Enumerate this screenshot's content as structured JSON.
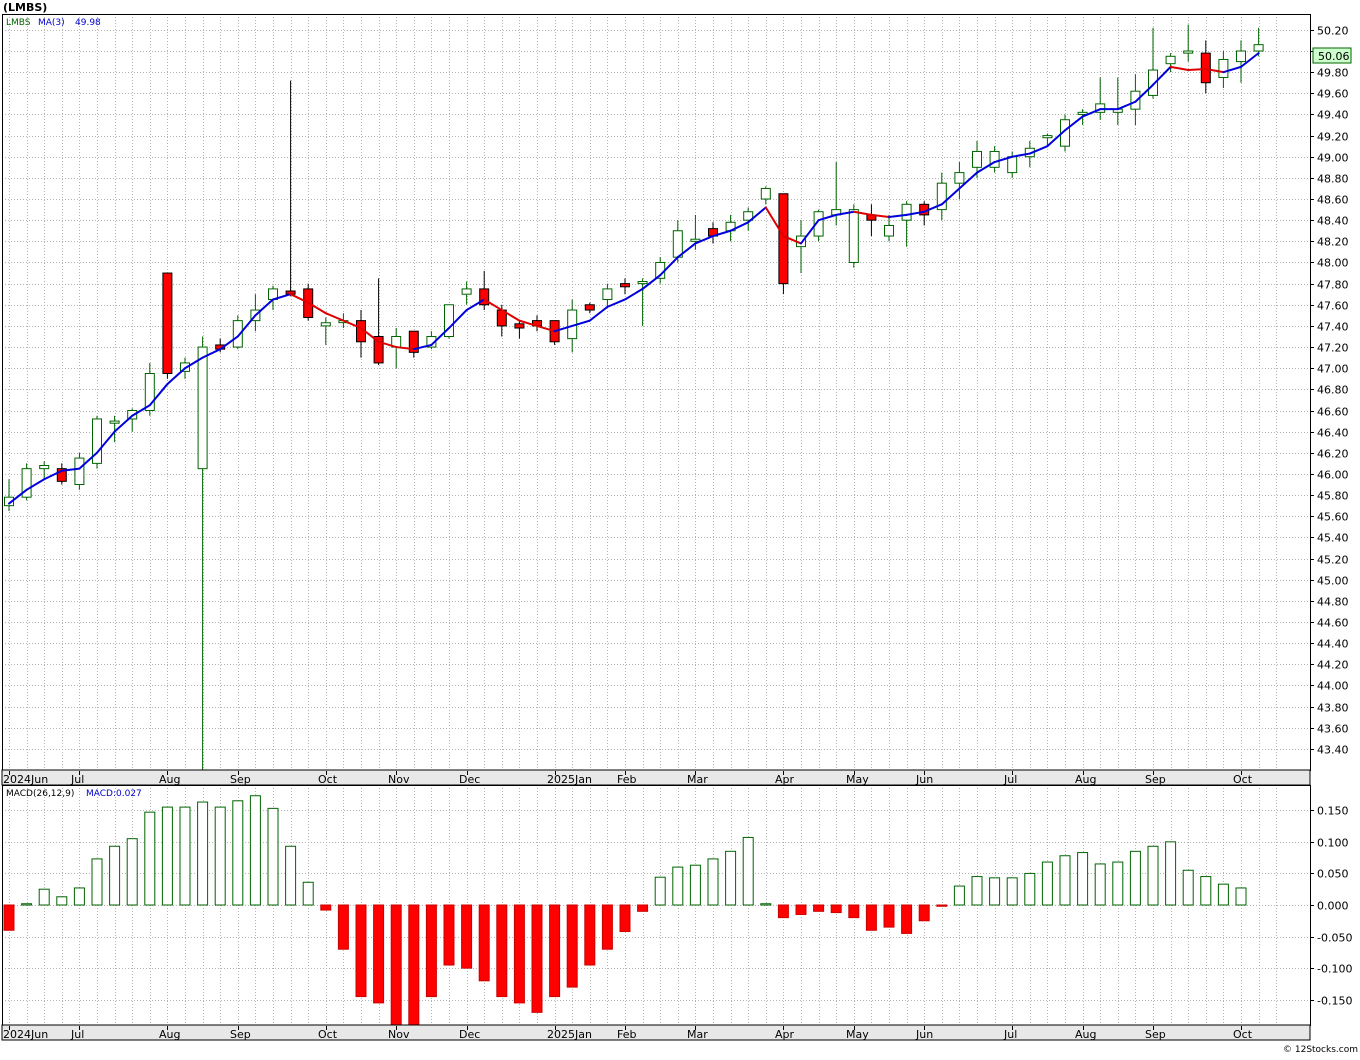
{
  "header": {
    "symbol_title": "(LMBS)",
    "legend_symbol": "LMBS",
    "legend_ma": "MA(3)",
    "legend_ma_value": "49.98",
    "last_price_label": "50.06"
  },
  "macd_legend": {
    "label": "MACD(26,12,9)",
    "value": "MACD:0.027"
  },
  "footer": {
    "copyright": "© 12Stocks.com"
  },
  "colors": {
    "up_candle_stroke": "#006400",
    "down_candle_fill": "#ff0000",
    "ma_up": "#0000dd",
    "ma_down": "#dd0000",
    "grid": "#b4b4b4",
    "price_label_bg": "#ccffcc"
  },
  "chart_data": [
    {
      "type": "candlestick",
      "ylim": [
        43.2,
        50.35
      ],
      "yticks": [
        43.4,
        43.6,
        43.8,
        44.0,
        44.2,
        44.4,
        44.6,
        44.8,
        45.0,
        45.2,
        45.4,
        45.6,
        45.8,
        46.0,
        46.2,
        46.4,
        46.6,
        46.8,
        47.0,
        47.2,
        47.4,
        47.6,
        47.8,
        48.0,
        48.2,
        48.4,
        48.6,
        48.8,
        49.0,
        49.2,
        49.4,
        49.6,
        49.8,
        50.0,
        50.2
      ],
      "ytick_labels": [
        "43.40",
        "43.60",
        "43.80",
        "44.00",
        "44.20",
        "44.40",
        "44.60",
        "44.80",
        "45.00",
        "45.20",
        "45.40",
        "45.60",
        "45.80",
        "46.00",
        "46.20",
        "46.40",
        "46.60",
        "46.80",
        "47.00",
        "47.20",
        "47.40",
        "47.60",
        "47.80",
        "48.00",
        "48.20",
        "48.40",
        "48.60",
        "48.80",
        "49.00",
        "49.20",
        "49.40",
        "49.60",
        "49.80",
        "50.00",
        "50.20"
      ],
      "x_month_labels": [
        "2024Jun",
        "Jul",
        "Aug",
        "Sep",
        "Oct",
        "Nov",
        "Dec",
        "2025Jan",
        "Feb",
        "Mar",
        "Apr",
        "May",
        "Jun",
        "Jul",
        "Aug",
        "Sep",
        "Oct"
      ],
      "x_month_week_index": [
        0,
        4,
        9,
        13,
        18,
        22,
        26,
        31,
        35,
        39,
        44,
        48,
        52,
        57,
        61,
        65,
        70
      ],
      "weeks": 73,
      "ohlc": [
        [
          45.7,
          45.95,
          45.65,
          45.78
        ],
        [
          45.78,
          46.1,
          45.75,
          46.05
        ],
        [
          46.05,
          46.12,
          45.95,
          46.08
        ],
        [
          46.05,
          46.1,
          45.9,
          45.93
        ],
        [
          45.9,
          46.2,
          45.85,
          46.15
        ],
        [
          46.1,
          46.55,
          46.05,
          46.52
        ],
        [
          46.48,
          46.55,
          46.3,
          46.5
        ],
        [
          46.52,
          46.62,
          46.4,
          46.6
        ],
        [
          46.6,
          47.05,
          46.55,
          46.95
        ],
        [
          47.9,
          47.9,
          46.9,
          46.95
        ],
        [
          46.97,
          47.1,
          46.9,
          47.05
        ],
        [
          46.05,
          47.3,
          43.2,
          47.2
        ],
        [
          47.22,
          47.28,
          47.15,
          47.18
        ],
        [
          47.2,
          47.5,
          47.18,
          47.45
        ],
        [
          47.45,
          47.7,
          47.35,
          47.55
        ],
        [
          47.65,
          47.78,
          47.55,
          47.75
        ],
        [
          47.73,
          49.72,
          47.68,
          47.7
        ],
        [
          47.75,
          47.8,
          47.45,
          47.48
        ],
        [
          47.4,
          47.48,
          47.22,
          47.43
        ],
        [
          47.45,
          47.52,
          47.38,
          47.45
        ],
        [
          47.45,
          47.55,
          47.1,
          47.25
        ],
        [
          47.3,
          47.85,
          47.03,
          47.05
        ],
        [
          47.2,
          47.38,
          47.0,
          47.3
        ],
        [
          47.35,
          47.35,
          47.1,
          47.15
        ],
        [
          47.2,
          47.35,
          47.18,
          47.3
        ],
        [
          47.3,
          47.6,
          47.28,
          47.6
        ],
        [
          47.7,
          47.82,
          47.6,
          47.75
        ],
        [
          47.75,
          47.92,
          47.55,
          47.6
        ],
        [
          47.55,
          47.6,
          47.3,
          47.4
        ],
        [
          47.42,
          47.45,
          47.28,
          47.38
        ],
        [
          47.45,
          47.5,
          47.35,
          47.4
        ],
        [
          47.45,
          47.45,
          47.22,
          47.25
        ],
        [
          47.28,
          47.65,
          47.15,
          47.55
        ],
        [
          47.6,
          47.62,
          47.52,
          47.55
        ],
        [
          47.65,
          47.8,
          47.58,
          47.75
        ],
        [
          47.8,
          47.85,
          47.7,
          47.77
        ],
        [
          47.8,
          47.85,
          47.4,
          47.82
        ],
        [
          47.85,
          48.05,
          47.8,
          48.0
        ],
        [
          48.05,
          48.4,
          48.0,
          48.3
        ],
        [
          48.2,
          48.45,
          48.12,
          48.22
        ],
        [
          48.32,
          48.38,
          48.18,
          48.25
        ],
        [
          48.3,
          48.45,
          48.2,
          48.38
        ],
        [
          48.4,
          48.52,
          48.3,
          48.48
        ],
        [
          48.6,
          48.72,
          48.55,
          48.7
        ],
        [
          48.65,
          48.65,
          47.7,
          47.8
        ],
        [
          48.15,
          48.4,
          47.9,
          48.25
        ],
        [
          48.25,
          48.5,
          48.2,
          48.48
        ],
        [
          48.45,
          48.95,
          48.35,
          48.5
        ],
        [
          48.0,
          48.55,
          47.95,
          48.5
        ],
        [
          48.45,
          48.55,
          48.25,
          48.4
        ],
        [
          48.25,
          48.45,
          48.2,
          48.35
        ],
        [
          48.4,
          48.58,
          48.15,
          48.55
        ],
        [
          48.55,
          48.58,
          48.35,
          48.45
        ],
        [
          48.5,
          48.85,
          48.4,
          48.75
        ],
        [
          48.75,
          48.95,
          48.6,
          48.85
        ],
        [
          48.9,
          49.15,
          48.8,
          49.05
        ],
        [
          48.9,
          49.1,
          48.85,
          49.05
        ],
        [
          48.85,
          49.05,
          48.8,
          49.0
        ],
        [
          49.0,
          49.15,
          48.9,
          49.08
        ],
        [
          49.18,
          49.22,
          49.1,
          49.2
        ],
        [
          49.1,
          49.4,
          49.05,
          49.35
        ],
        [
          49.4,
          49.45,
          49.3,
          49.42
        ],
        [
          49.42,
          49.75,
          49.35,
          49.5
        ],
        [
          49.42,
          49.75,
          49.3,
          49.45
        ],
        [
          49.45,
          49.78,
          49.3,
          49.62
        ],
        [
          49.58,
          50.22,
          49.55,
          49.82
        ],
        [
          49.88,
          49.98,
          49.8,
          49.95
        ],
        [
          49.98,
          50.25,
          49.9,
          50.0
        ],
        [
          49.98,
          50.1,
          49.6,
          49.7
        ],
        [
          49.75,
          50.0,
          49.65,
          49.92
        ],
        [
          49.9,
          50.1,
          49.7,
          50.0
        ],
        [
          50.0,
          50.22,
          49.95,
          50.06
        ]
      ],
      "ma3": [
        45.72,
        45.85,
        45.95,
        46.03,
        46.05,
        46.2,
        46.4,
        46.55,
        46.65,
        46.85,
        47.0,
        47.1,
        47.18,
        47.3,
        47.5,
        47.65,
        47.7,
        47.62,
        47.52,
        47.45,
        47.38,
        47.25,
        47.2,
        47.18,
        47.22,
        47.38,
        47.55,
        47.65,
        47.55,
        47.45,
        47.4,
        47.35,
        47.4,
        47.45,
        47.58,
        47.65,
        47.75,
        47.88,
        48.05,
        48.18,
        48.25,
        48.3,
        48.38,
        48.52,
        48.25,
        48.18,
        48.4,
        48.45,
        48.48,
        48.45,
        48.43,
        48.45,
        48.48,
        48.55,
        48.7,
        48.85,
        48.95,
        49.0,
        49.03,
        49.1,
        49.25,
        49.38,
        49.45,
        49.45,
        49.52,
        49.68,
        49.85,
        49.82,
        49.83,
        49.8,
        49.85,
        49.98
      ],
      "ma3_direction": [
        "up",
        "up",
        "up",
        "up",
        "up",
        "up",
        "up",
        "up",
        "up",
        "up",
        "up",
        "up",
        "up",
        "up",
        "up",
        "up",
        "up",
        "down",
        "down",
        "down",
        "down",
        "down",
        "down",
        "down",
        "up",
        "up",
        "up",
        "up",
        "down",
        "down",
        "down",
        "down",
        "up",
        "up",
        "up",
        "up",
        "up",
        "up",
        "up",
        "up",
        "up",
        "up",
        "up",
        "up",
        "down",
        "down",
        "up",
        "up",
        "up",
        "down",
        "down",
        "up",
        "up",
        "up",
        "up",
        "up",
        "up",
        "up",
        "up",
        "up",
        "up",
        "up",
        "up",
        "up",
        "up",
        "up",
        "up",
        "down",
        "down",
        "down",
        "up",
        "up"
      ]
    },
    {
      "type": "bar",
      "title": "MACD(26,12,9)",
      "ylim": [
        -0.19,
        0.19
      ],
      "yticks": [
        -0.15,
        -0.1,
        -0.05,
        0.0,
        0.05,
        0.1,
        0.15
      ],
      "ytick_labels": [
        "-0.150",
        "-0.100",
        "-0.050",
        "0.000",
        "0.050",
        "0.100",
        "0.150"
      ],
      "x_month_labels": [
        "2024Jun",
        "Jul",
        "Aug",
        "Sep",
        "Oct",
        "Nov",
        "Dec",
        "2025Jan",
        "Feb",
        "Mar",
        "Apr",
        "May",
        "Jun",
        "Jul",
        "Aug",
        "Sep",
        "Oct"
      ],
      "values": [
        -0.04,
        0.002,
        0.025,
        0.013,
        0.027,
        0.073,
        0.093,
        0.105,
        0.147,
        0.155,
        0.155,
        0.163,
        0.155,
        0.165,
        0.173,
        0.153,
        0.093,
        0.036,
        -0.008,
        -0.07,
        -0.145,
        -0.155,
        -0.19,
        -0.19,
        -0.145,
        -0.095,
        -0.1,
        -0.12,
        -0.145,
        -0.155,
        -0.17,
        -0.145,
        -0.13,
        -0.095,
        -0.07,
        -0.042,
        -0.01,
        0.044,
        0.06,
        0.063,
        0.073,
        0.085,
        0.107,
        0.002,
        -0.02,
        -0.015,
        -0.01,
        -0.012,
        -0.02,
        -0.04,
        -0.035,
        -0.045,
        -0.025,
        -0.002,
        0.03,
        0.045,
        0.043,
        0.043,
        0.05,
        0.068,
        0.078,
        0.083,
        0.065,
        0.068,
        0.085,
        0.093,
        0.1,
        0.055,
        0.045,
        0.033,
        0.027
      ]
    }
  ]
}
